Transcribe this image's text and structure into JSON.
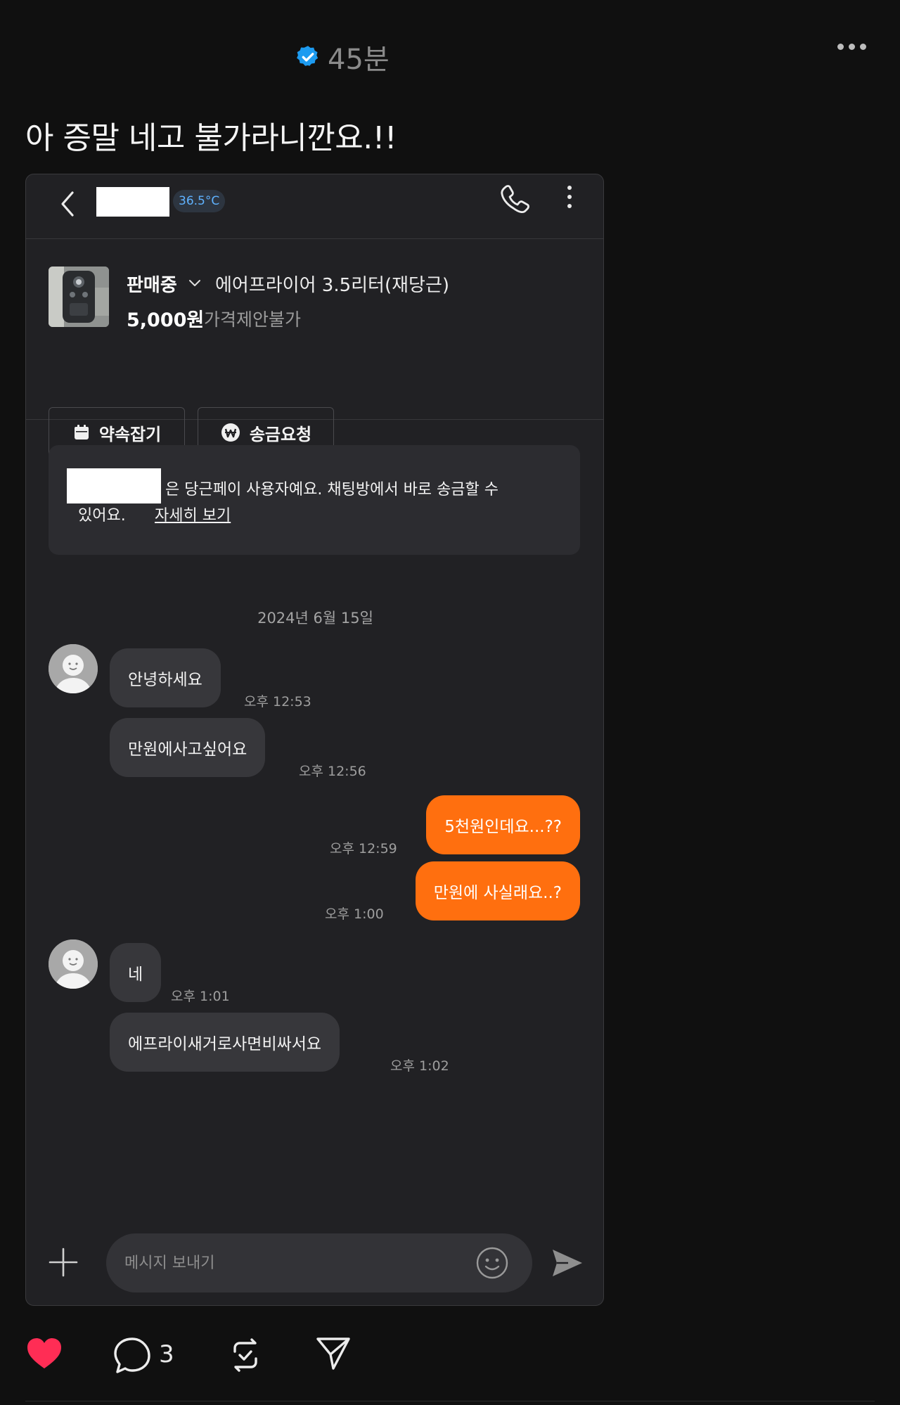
{
  "post": {
    "time": "45분",
    "text": "아 증말 네고 불가라니깐요.!!",
    "reply_count": "3",
    "accent": "#1d9bf0",
    "like_color": "#ff2d55"
  },
  "chat": {
    "temperature": "36.5°C",
    "product": {
      "status": "판매중",
      "title": "에어프라이어 3.5리터(재당근)",
      "price": "5,000원",
      "nego": "가격제안불가"
    },
    "buttons": {
      "appointment": "약속잡기",
      "transfer": "송금요청"
    },
    "notice": {
      "line1": "은 당근페이 사용자예요. 채팅방에서 바로 송금할 수",
      "line2": "있어요.",
      "link": "자세히 보기"
    },
    "date": "2024년 6월 15일",
    "messages": [
      {
        "text": "안녕하세요",
        "time": "오후 12:53",
        "side": "in"
      },
      {
        "text": "만원에사고싶어요",
        "time": "오후 12:56",
        "side": "in"
      },
      {
        "text": "5천원인데요...??",
        "time": "오후 12:59",
        "side": "out"
      },
      {
        "text": "만원에 사실래요..?",
        "time": "오후 1:00",
        "side": "out"
      },
      {
        "text": "네",
        "time": "오후 1:01",
        "side": "in"
      },
      {
        "text": "에프라이새거로사면비싸서요",
        "time": "오후 1:02",
        "side": "in"
      }
    ],
    "input_placeholder": "메시지 보내기",
    "brand_orange": "#ff6f0f"
  }
}
